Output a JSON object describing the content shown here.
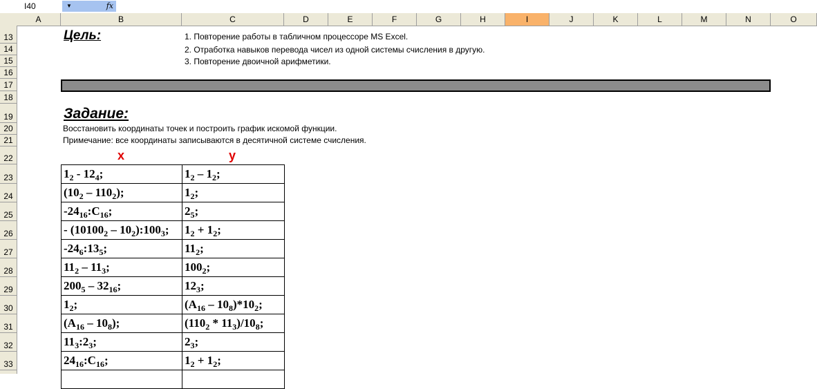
{
  "formula_bar": {
    "name_box": "I40",
    "fx": "fx",
    "formula": ""
  },
  "columns": [
    "A",
    "B",
    "C",
    "D",
    "E",
    "F",
    "G",
    "H",
    "I",
    "J",
    "K",
    "L",
    "M",
    "N",
    "O"
  ],
  "selected_column": "I",
  "rows": [
    "13",
    "14",
    "15",
    "16",
    "17",
    "18",
    "19",
    "20",
    "21",
    "22",
    "23",
    "24",
    "25",
    "26",
    "27",
    "28",
    "29",
    "30",
    "31",
    "32",
    "33"
  ],
  "goal": {
    "title": "Цель:",
    "items": [
      "1. Повторение работы в табличном процессоре MS Excel.",
      "2. Отработка навыков перевода чисел из одной системы счисления в другую.",
      "3. Повторение двоичной арифметики."
    ]
  },
  "task": {
    "title": "Задание:",
    "lines": [
      "Восстановить координаты точек и построить график искомой функции.",
      "Примечание: все координаты записываются в десятичной системе счисления."
    ]
  },
  "table": {
    "x_header": "x",
    "y_header": "y",
    "rows": [
      [
        [
          [
            "1",
            "2"
          ],
          [
            " - 12",
            "4"
          ],
          [
            ";",
            ""
          ]
        ],
        [
          [
            "1",
            "2"
          ],
          [
            " – 1",
            "2"
          ],
          [
            ";",
            ""
          ]
        ]
      ],
      [
        [
          [
            "(10",
            "2"
          ],
          [
            " – 110",
            "2"
          ],
          [
            ");",
            ""
          ]
        ],
        [
          [
            "1",
            "2"
          ],
          [
            ";",
            ""
          ]
        ]
      ],
      [
        [
          [
            "-24",
            "16"
          ],
          [
            ":C",
            "16"
          ],
          [
            ";",
            ""
          ]
        ],
        [
          [
            "2",
            "5"
          ],
          [
            ";",
            ""
          ]
        ]
      ],
      [
        [
          [
            "- (10100",
            "2"
          ],
          [
            " – 10",
            "2"
          ],
          [
            "):100",
            "3"
          ],
          [
            ";",
            ""
          ]
        ],
        [
          [
            "1",
            "2"
          ],
          [
            " + 1",
            "2"
          ],
          [
            ";",
            ""
          ]
        ]
      ],
      [
        [
          [
            "-24",
            "6"
          ],
          [
            ":13",
            "5"
          ],
          [
            ";",
            ""
          ]
        ],
        [
          [
            "11",
            "2"
          ],
          [
            ";",
            ""
          ]
        ]
      ],
      [
        [
          [
            "11",
            "2"
          ],
          [
            " – 11",
            "3"
          ],
          [
            ";",
            ""
          ]
        ],
        [
          [
            "100",
            "2"
          ],
          [
            ";",
            ""
          ]
        ]
      ],
      [
        [
          [
            "200",
            "5"
          ],
          [
            " – 32",
            "16"
          ],
          [
            ";",
            ""
          ]
        ],
        [
          [
            "12",
            "3"
          ],
          [
            ";",
            ""
          ]
        ]
      ],
      [
        [
          [
            "1",
            "2"
          ],
          [
            ";",
            ""
          ]
        ],
        [
          [
            "(A",
            "16"
          ],
          [
            " – 10",
            "8"
          ],
          [
            ")*10",
            "2"
          ],
          [
            ";",
            ""
          ]
        ]
      ],
      [
        [
          [
            "(A",
            "16"
          ],
          [
            " – 10",
            "8"
          ],
          [
            ");",
            ""
          ]
        ],
        [
          [
            "(110",
            "2"
          ],
          [
            " * 11",
            "3"
          ],
          [
            ")/10",
            "8"
          ],
          [
            ";",
            ""
          ]
        ]
      ],
      [
        [
          [
            "11",
            "3"
          ],
          [
            ":2",
            "3"
          ],
          [
            ";",
            ""
          ]
        ],
        [
          [
            "2",
            "3"
          ],
          [
            ";",
            ""
          ]
        ]
      ],
      [
        [
          [
            "24",
            "16"
          ],
          [
            ":C",
            "16"
          ],
          [
            ";",
            ""
          ]
        ],
        [
          [
            "1",
            "2"
          ],
          [
            " + 1",
            "2"
          ],
          [
            ";",
            ""
          ]
        ]
      ],
      [
        [
          [
            "",
            ""
          ]
        ],
        [
          [
            "",
            ""
          ]
        ]
      ]
    ]
  }
}
